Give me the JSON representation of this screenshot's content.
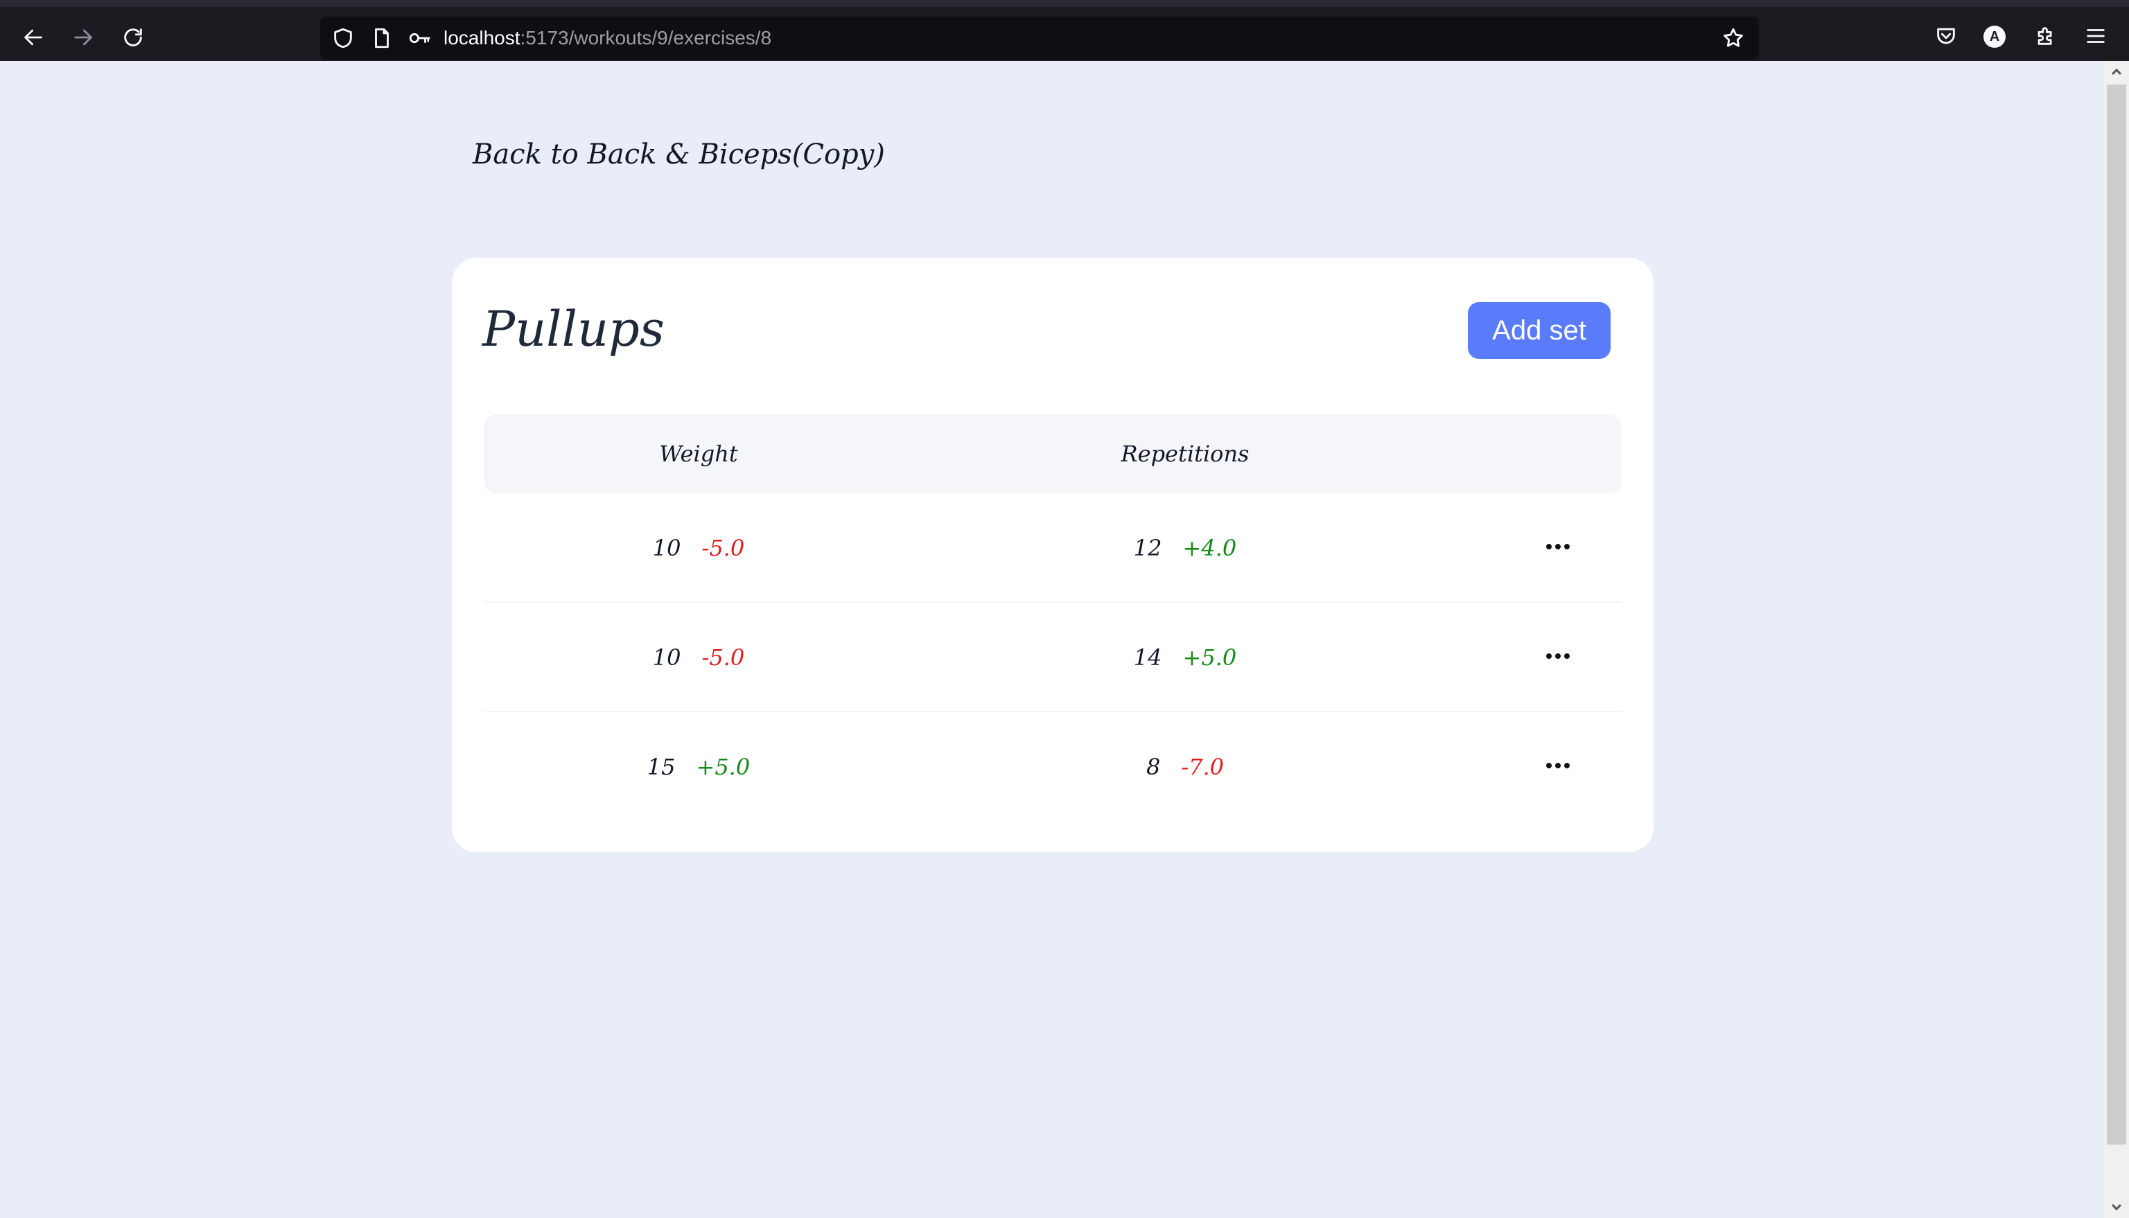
{
  "browser": {
    "url_host": "localhost",
    "url_path": ":5173/workouts/9/exercises/8",
    "avatar_letter": "A"
  },
  "page": {
    "back_link": "Back to Back & Biceps(Copy)",
    "exercise_title": "Pullups",
    "add_set_label": "Add set",
    "columns": {
      "weight": "Weight",
      "repetitions": "Repetitions"
    },
    "sets": [
      {
        "weight": "10",
        "weight_delta": "-5.0",
        "weight_delta_color": "#e11d1d",
        "reps": "12",
        "reps_delta": "+4.0",
        "reps_delta_color": "#158a1a"
      },
      {
        "weight": "10",
        "weight_delta": "-5.0",
        "weight_delta_color": "#e11d1d",
        "reps": "14",
        "reps_delta": "+5.0",
        "reps_delta_color": "#158a1a"
      },
      {
        "weight": "15",
        "weight_delta": "+5.0",
        "weight_delta_color": "#158a1a",
        "reps": "8",
        "reps_delta": "-7.0",
        "reps_delta_color": "#e11d1d"
      }
    ]
  },
  "colors": {
    "background": "#e8edf7",
    "accent": "#5b7cfa",
    "positive": "#158a1a",
    "negative": "#e11d1d"
  },
  "icons": {
    "back": "arrow-left-icon",
    "forward": "arrow-right-icon",
    "reload": "reload-icon",
    "shield": "shield-icon",
    "page": "page-icon",
    "key": "key-icon",
    "bookmark": "star-icon",
    "pocket": "pocket-icon",
    "extensions": "puzzle-icon",
    "menu": "hamburger-menu-icon",
    "more": "more-horizontal-icon"
  }
}
